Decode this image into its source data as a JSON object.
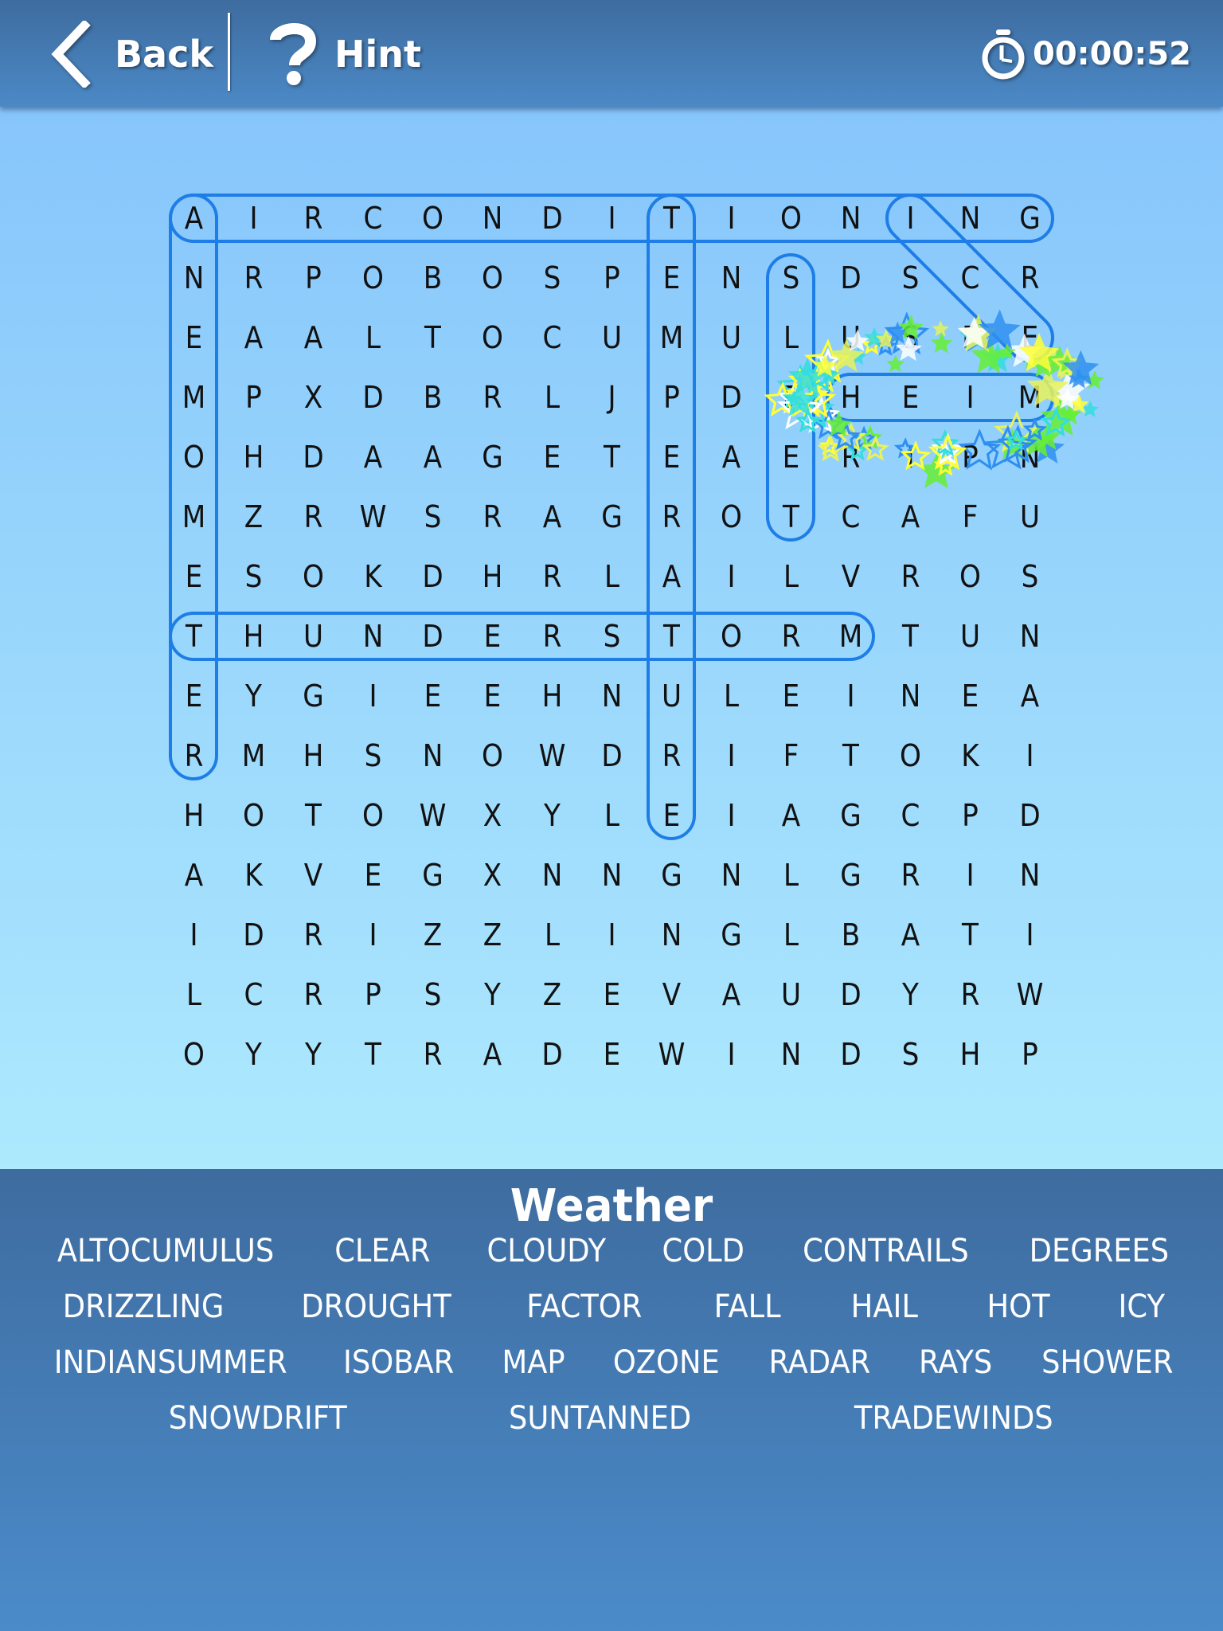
{
  "header": {
    "back_label": "Back",
    "hint_label": "Hint",
    "timer": "00:00:52"
  },
  "grid": {
    "rows": [
      "AIRCONDITIONING",
      "NRPOBOSPENSDSCR",
      "EAALTOCUMULUSPE",
      "MPXDBRLJPDEHEIM",
      "OHDAAGETEAERIPN",
      "MZRWSRAGROTCAFU",
      "ESOKDHRLAILVROS",
      "THUNDERSTORMTUN",
      "EYGIEEHNULEINEA",
      "RMHSNOWDRIFTOKI",
      "HOTOWXYLEIAGCPD",
      "AKVEGXNNGNLGRIN",
      "IDRIZZLINGLBATI",
      "LCRPSYZEVAUDYRW",
      "OYYTRADEWINDSHP"
    ],
    "found_words": [
      {
        "word": "AIRCONDITIONING",
        "start": [
          0,
          0
        ],
        "end": [
          0,
          14
        ]
      },
      {
        "word": "ANEMOMETER",
        "start": [
          0,
          0
        ],
        "end": [
          9,
          0
        ]
      },
      {
        "word": "TEMPERATURE",
        "start": [
          0,
          8
        ],
        "end": [
          10,
          8
        ]
      },
      {
        "word": "SLEET",
        "start": [
          1,
          10
        ],
        "end": [
          5,
          10
        ]
      },
      {
        "word": "THUNDERSTORM",
        "start": [
          7,
          0
        ],
        "end": [
          7,
          11
        ]
      },
      {
        "word": "ICE",
        "start": [
          0,
          12
        ],
        "end": [
          2,
          14
        ]
      },
      {
        "word": "HEIM",
        "start": [
          3,
          11
        ],
        "end": [
          3,
          14
        ],
        "just_found": true
      }
    ],
    "highlight_color": "#1e7de6"
  },
  "word_list": {
    "category": "Weather",
    "rows": [
      [
        "ALTOCUMULUS",
        "CLEAR",
        "CLOUDY",
        "COLD",
        "CONTRAILS",
        "DEGREES"
      ],
      [
        "DRIZZLING",
        "DROUGHT",
        "FACTOR",
        "FALL",
        "HAIL",
        "HOT",
        "ICY"
      ],
      [
        "INDIANSUMMER",
        "ISOBAR",
        "MAP",
        "OZONE",
        "RADAR",
        "RAYS",
        "SHOWER"
      ],
      [
        "SNOWDRIFT",
        "SUNTANNED",
        "TRADEWINDS"
      ]
    ]
  }
}
